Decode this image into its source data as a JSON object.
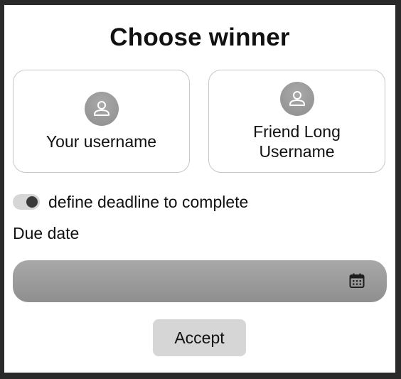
{
  "dialog": {
    "title": "Choose winner",
    "players": [
      {
        "name": "Your username",
        "icon": "user-icon"
      },
      {
        "name": "Friend Long Username",
        "icon": "user-icon"
      }
    ],
    "deadline_toggle": {
      "label": "define deadline to complete",
      "checked": true
    },
    "due_date": {
      "label": "Due date",
      "value": "",
      "icon": "calendar-icon"
    },
    "accept_label": "Accept"
  }
}
